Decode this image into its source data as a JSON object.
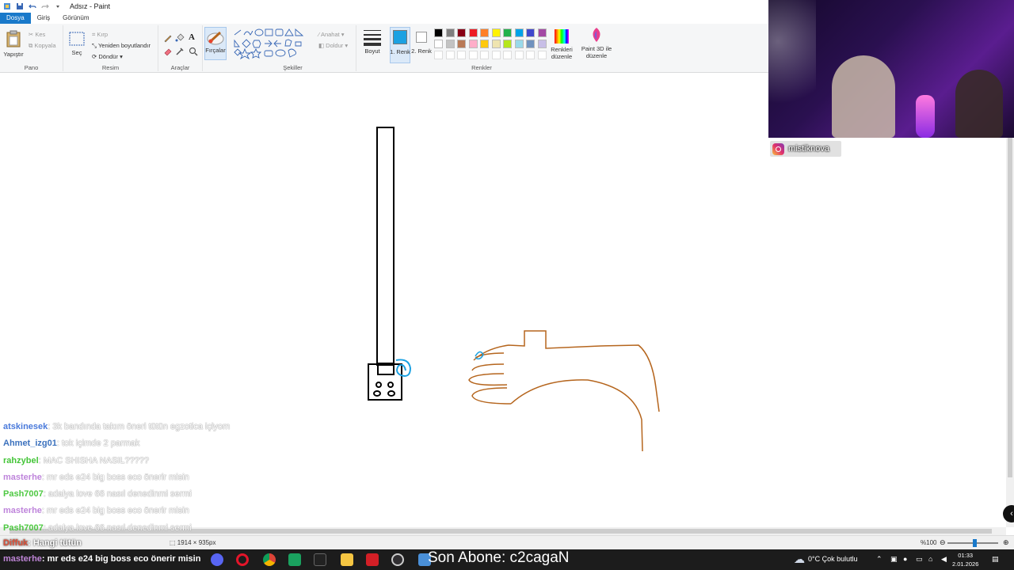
{
  "window": {
    "title": "Adsız - Paint"
  },
  "menu_tabs": [
    {
      "label": "Dosya",
      "active": true
    },
    {
      "label": "Giriş",
      "active": false
    },
    {
      "label": "Görünüm",
      "active": false
    }
  ],
  "ribbon": {
    "clipboard": {
      "paste": "Yapıştır",
      "cut": "Kes",
      "copy": "Kopyala",
      "group": "Pano"
    },
    "image": {
      "select": "Seç",
      "crop": "Kırp",
      "resize": "Yeniden boyutlandır",
      "rotate": "Döndür",
      "group": "Resim"
    },
    "tools": {
      "group": "Araçlar"
    },
    "brushes": {
      "label": "Fırçalar"
    },
    "shapes": {
      "outline": "Anahat",
      "fill": "Doldur",
      "group": "Şekiller"
    },
    "size": {
      "label": "Boyut"
    },
    "colors": {
      "color1": "1. Renk",
      "color2": "2. Renk",
      "edit": "Renkleri düzenle",
      "group": "Renkler",
      "color1_value": "#1ba1e2",
      "color2_value": "#ffffff",
      "palette_row1": [
        "#000000",
        "#7f7f7f",
        "#880015",
        "#ed1c24",
        "#ff7f27",
        "#fff200",
        "#22b14c",
        "#00a2e8",
        "#3f48cc",
        "#a349a4"
      ],
      "palette_row2": [
        "#ffffff",
        "#c3c3c3",
        "#b97a57",
        "#ffaec9",
        "#ffc90e",
        "#efe4b0",
        "#b5e61d",
        "#99d9ea",
        "#7092be",
        "#c8bfe7"
      ]
    },
    "paint3d": {
      "label": "Paint 3D ile düzenle"
    }
  },
  "status_bar": {
    "dimensions": "1914 × 935px",
    "zoom": "%100"
  },
  "overlay": {
    "instagram_handle": "mistiknova",
    "chat": [
      {
        "user": "atskinesek",
        "user_color": "#3b6fd8",
        "message": ": 3k bandında takım öneri tütün egzotica içiyom"
      },
      {
        "user": "Ahmet_izg01",
        "user_color": "#2b65b8",
        "message": ": tok içimde 2 parmak"
      },
      {
        "user": "rahzybel",
        "user_color": "#34c027",
        "message": ": MAC SHISHA NASIL?????"
      },
      {
        "user": "masterhe",
        "user_color": "#b97ad8",
        "message": ": mr eds e24 big boss eco önerir misin"
      },
      {
        "user": "Pash7007",
        "user_color": "#3fc432",
        "message": ": adalya love 66 nasıl denedinmi sermi"
      },
      {
        "user": "masterhe",
        "user_color": "#b97ad8",
        "message": ": mr eds e24 big boss eco önerir misin"
      },
      {
        "user": "Pash7007",
        "user_color": "#3fc432",
        "message": ": adalya love 66 nasıl denedinmi sermi"
      }
    ],
    "partial_chat": {
      "user": "Diffuk",
      "message": ": Hangi tütün"
    },
    "bottom_chat": {
      "user": "masterhe",
      "message": ": mr eds e24 big boss eco önerir misin"
    },
    "subscriber_banner": "Son Abone: c2cagaN"
  },
  "taskbar": {
    "weather": "0°C  Çok bulutlu",
    "time": "01:33",
    "date": "2.01.2026"
  }
}
